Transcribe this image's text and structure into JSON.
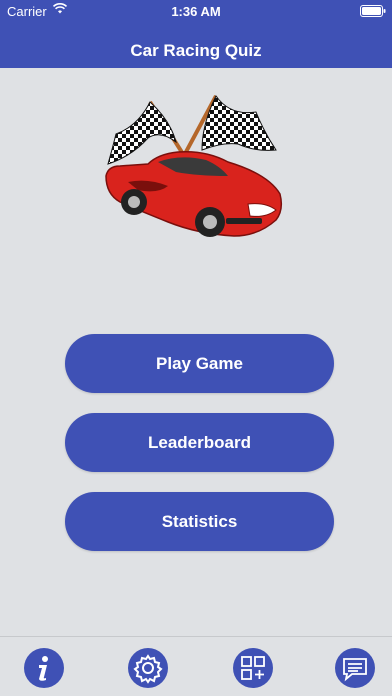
{
  "status_bar": {
    "carrier": "Carrier",
    "time": "1:36 AM"
  },
  "header": {
    "title": "Car Racing Quiz"
  },
  "menu": {
    "play_label": "Play Game",
    "leaderboard_label": "Leaderboard",
    "statistics_label": "Statistics"
  },
  "tabbar": {
    "icons": [
      "info-icon",
      "gear-icon",
      "apps-add-icon",
      "chat-icon"
    ]
  },
  "colors": {
    "accent": "#3f51b5",
    "background": "#dfe1e4",
    "car": "#d9231d"
  }
}
